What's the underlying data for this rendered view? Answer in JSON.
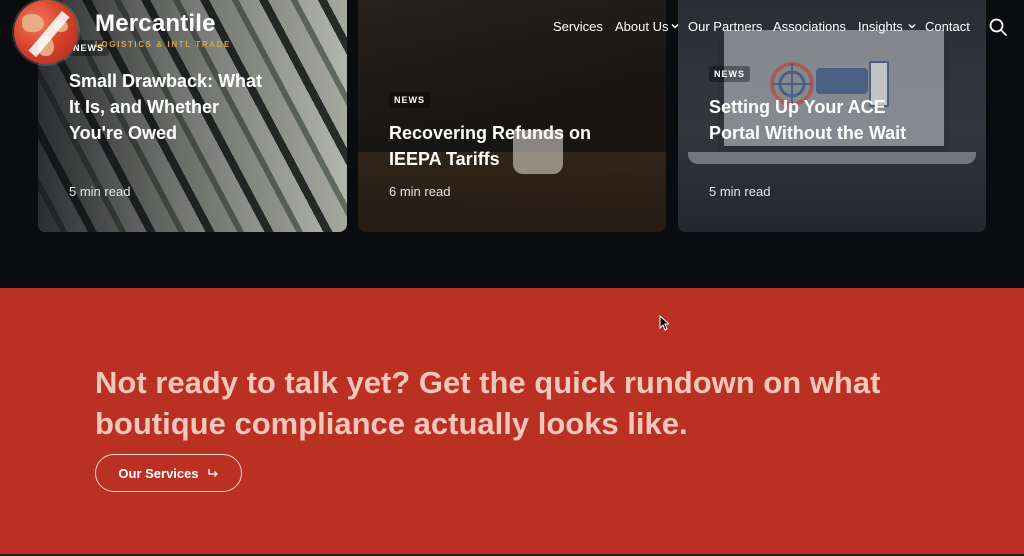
{
  "header": {
    "brand_name": "Mercantile",
    "brand_tagline": "LOGISTICS & INTL TRADE",
    "logo_icon": "globe-logo-icon",
    "nav": [
      {
        "label": "Services",
        "has_dropdown": false
      },
      {
        "label": "About Us",
        "has_dropdown": true
      },
      {
        "label": "Our Partners",
        "has_dropdown": false
      },
      {
        "label": "Associations",
        "has_dropdown": false
      },
      {
        "label": "Insights",
        "has_dropdown": true
      },
      {
        "label": "Contact",
        "has_dropdown": false
      }
    ],
    "search_icon": "search-icon"
  },
  "cards": [
    {
      "tag": "NEWS",
      "title": "Small Drawback: What It Is, and Whether You're Owed",
      "meta": "5 min read"
    },
    {
      "tag": "NEWS",
      "title": "Recovering Refunds on IEEPA Tariffs",
      "meta": "6 min read"
    },
    {
      "tag": "NEWS",
      "title": "Setting Up Your ACE Portal Without the Wait",
      "meta": "5 min read"
    }
  ],
  "cta": {
    "heading": "Not ready to talk yet? Get the quick rundown on what boutique compliance actually looks like.",
    "button_label": "Our Services",
    "button_icon": "arrow-return-icon"
  },
  "colors": {
    "cta_background": "#ba3124",
    "cta_heading": "#f5c6ba",
    "brand_accent": "#d9a441",
    "page_dark": "#0b0c10"
  }
}
